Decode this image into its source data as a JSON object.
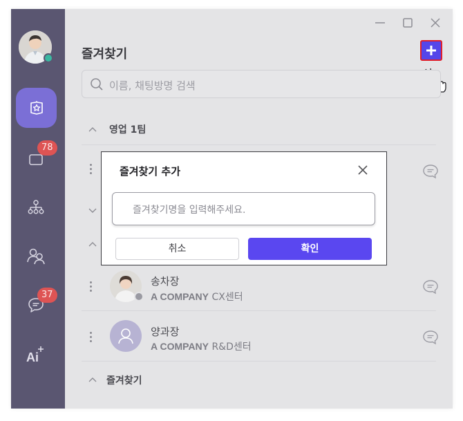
{
  "app": {
    "title": "즐겨찾기",
    "search_placeholder": "이름, 채팅방명 검색"
  },
  "sidebar": {
    "badges": {
      "chat_count": "78",
      "message_count": "37"
    },
    "ai_label": "Ai"
  },
  "colors": {
    "sidebar_bg": "#5a5671",
    "accent": "#5546ea",
    "badge": "#de5454",
    "online": "#3ab7a0"
  },
  "groups": [
    {
      "label": "영업 1팀",
      "state": "expanded"
    },
    {
      "label": "즐겨찾기",
      "state": "expanded"
    }
  ],
  "members": [
    {
      "name": "송차장",
      "company": "A COMPANY",
      "dept": "CX센터",
      "status": "offline"
    },
    {
      "name": "양과장",
      "company": "A COMPANY",
      "dept": "R&D센터",
      "status": "none"
    }
  ],
  "dialog": {
    "title": "즐겨찾기 추가",
    "input_placeholder": "즐겨찾기명을 입력해주세요.",
    "cancel_label": "취소",
    "confirm_label": "확인"
  },
  "icons": {
    "window": [
      "minimize-icon",
      "maximize-icon",
      "close-icon"
    ],
    "sidebar": [
      "star-icon",
      "chat-icon",
      "org-chart-icon",
      "contacts-icon",
      "message-icon",
      "ai-icon"
    ]
  }
}
